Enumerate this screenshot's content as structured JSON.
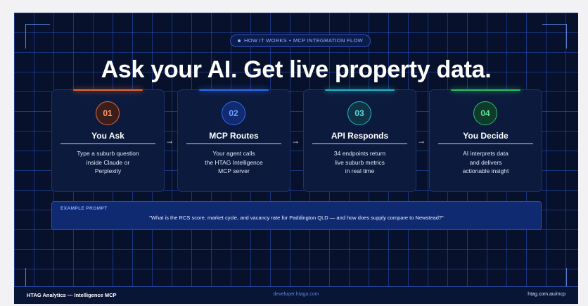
{
  "badge": {
    "left": "HOW IT WORKS",
    "separator": "•",
    "right": "MCP INTEGRATION FLOW"
  },
  "headline": "Ask your AI. Get live property data.",
  "steps": [
    {
      "num": "01",
      "title": "You Ask",
      "lines": [
        "Type a suburb question",
        "inside Claude or",
        "Perplexity"
      ],
      "accent": "#e0693a"
    },
    {
      "num": "02",
      "title": "MCP Routes",
      "lines": [
        "Your agent calls",
        "the HTAG Intelligence",
        "MCP server"
      ],
      "accent": "#2f6cf0"
    },
    {
      "num": "03",
      "title": "API Responds",
      "lines": [
        "34 endpoints return",
        "live suburb metrics",
        "in real time"
      ],
      "accent": "#21b7c9"
    },
    {
      "num": "04",
      "title": "You Decide",
      "lines": [
        "AI interprets data",
        "and delivers",
        "actionable insight"
      ],
      "accent": "#27c26a"
    }
  ],
  "arrow_glyph": "→",
  "prompt": {
    "label": "EXAMPLE PROMPT",
    "text": "\"What is the RCS score, market cycle, and vacancy rate for Paddington QLD — and how does supply compare to Newstead?\""
  },
  "footer": {
    "left": "HTAG Analytics — Intelligence MCP",
    "center": "developer.htaga.com",
    "right": "htag.com.au/mcp"
  },
  "colors": {
    "background": "#07112b",
    "grid": "#2850c8",
    "prompt_bg": "#102a72"
  }
}
